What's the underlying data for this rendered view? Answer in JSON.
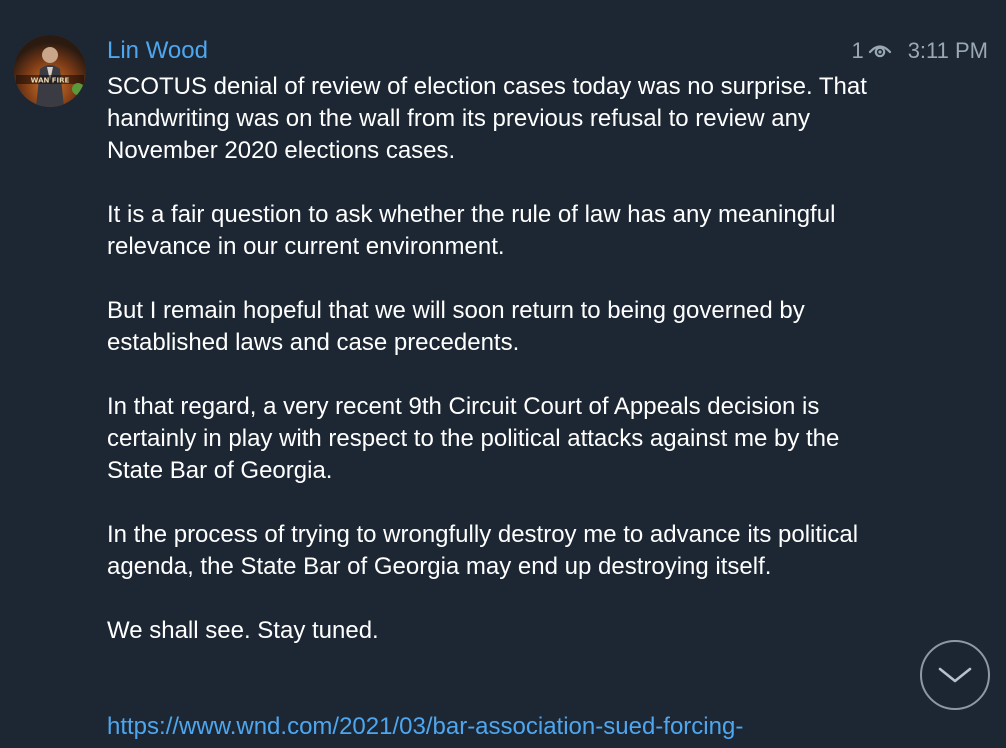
{
  "message": {
    "sender": "Lin Wood",
    "views": "1",
    "time": "3:11 PM",
    "paragraphs": [
      "SCOTUS denial of review of election cases today was no surprise. That handwriting was on the wall from its previous refusal to review any November 2020 elections cases.",
      "It is a fair question to ask whether the rule of law has any meaningful relevance in our current environment.",
      "But I remain hopeful that we will soon return to being governed by established laws and case precedents.",
      "In that regard, a very recent 9th Circuit Court of Appeals decision is certainly in play with respect to the political attacks against me by the State Bar of Georgia.",
      "In the process of trying to wrongfully destroy me to advance its political agenda, the State Bar of Georgia may end up destroying itself.",
      "We shall see. Stay tuned."
    ],
    "link": "https://www.wnd.com/2021/03/bar-association-sued-forcing-"
  },
  "icons": {
    "views": "eye-icon",
    "scroll": "chevron-down-icon"
  },
  "colors": {
    "background": "#1d2733",
    "accent": "#4ea6ee",
    "text": "#ffffff",
    "muted": "#9aa7b4"
  }
}
